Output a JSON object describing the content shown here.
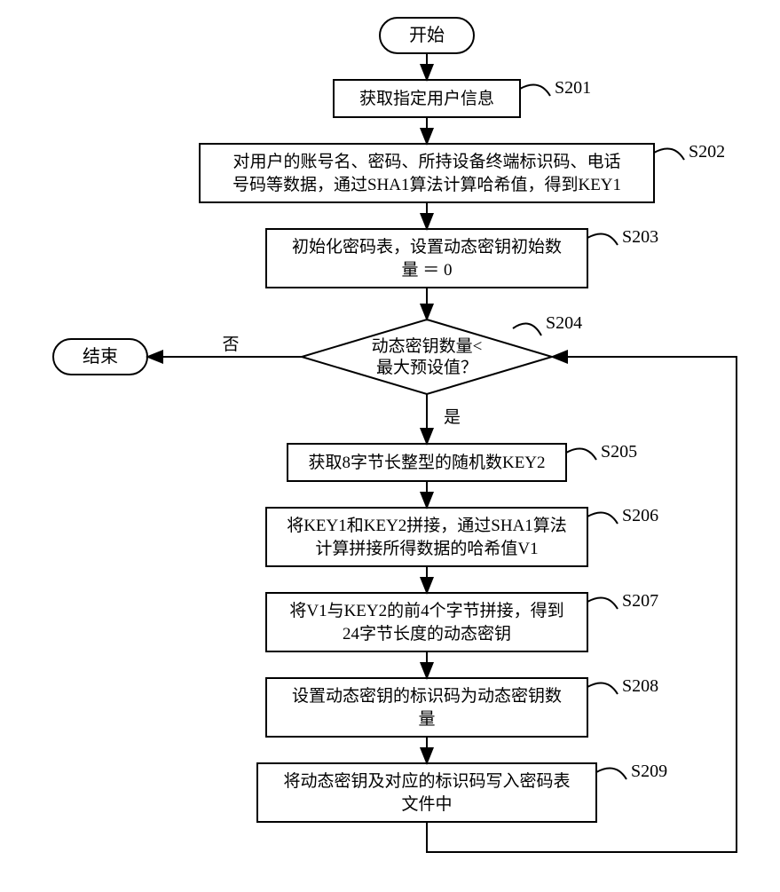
{
  "terminals": {
    "start": "开始",
    "end": "结束"
  },
  "steps": {
    "s201": {
      "label": "S201",
      "text": "获取指定用户信息"
    },
    "s202": {
      "label": "S202",
      "text_l1": "对用户的账号名、密码、所持设备终端标识码、电话",
      "text_l2": "号码等数据，通过SHA1算法计算哈希值，得到KEY1"
    },
    "s203": {
      "label": "S203",
      "text_l1": "初始化密码表，设置动态密钥初始数",
      "text_l2": "量 ＝ 0"
    },
    "s204": {
      "label": "S204",
      "text_l1": "动态密钥数量<",
      "text_l2": "最大预设值？"
    },
    "s205": {
      "label": "S205",
      "text": "获取8字节长整型的随机数KEY2"
    },
    "s206": {
      "label": "S206",
      "text_l1": "将KEY1和KEY2拼接，通过SHA1算法",
      "text_l2": "计算拼接所得数据的哈希值V1"
    },
    "s207": {
      "label": "S207",
      "text_l1": "将V1与KEY2的前4个字节拼接，得到",
      "text_l2": "24字节长度的动态密钥"
    },
    "s208": {
      "label": "S208",
      "text_l1": "设置动态密钥的标识码为动态密钥数",
      "text_l2": "量"
    },
    "s209": {
      "label": "S209",
      "text_l1": "将动态密钥及对应的标识码写入密码表",
      "text_l2": "文件中"
    }
  },
  "branches": {
    "yes": "是",
    "no": "否"
  }
}
